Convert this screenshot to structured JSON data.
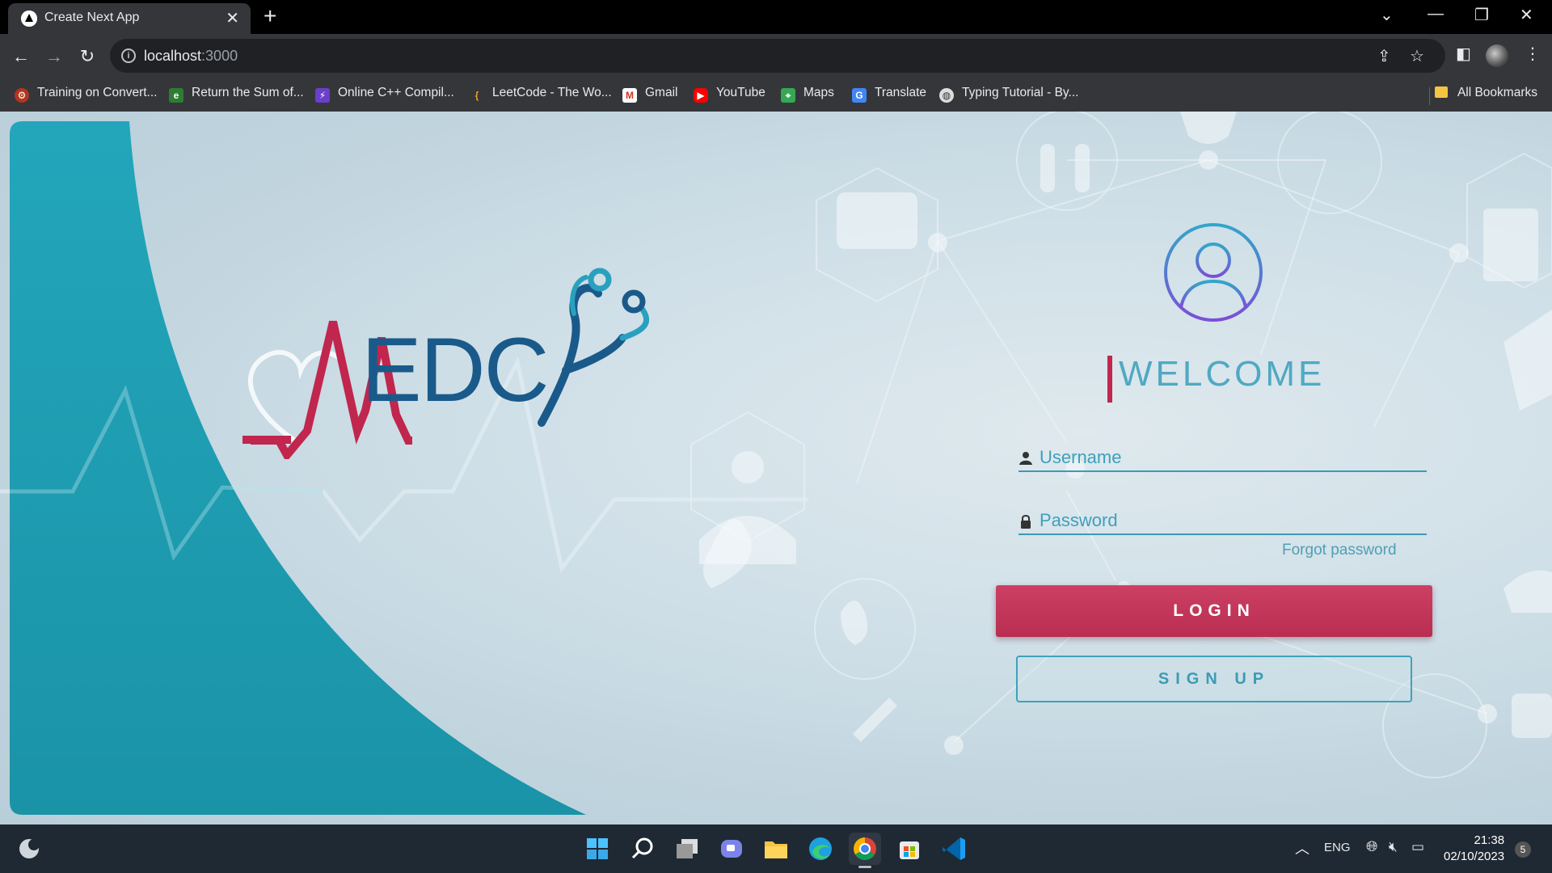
{
  "browser": {
    "tab_title": "Create Next App",
    "url_host": "localhost",
    "url_port": ":3000",
    "bookmarks": [
      {
        "label": "Training on Convert...",
        "icon": "codewars-icon",
        "color": "#b1361e"
      },
      {
        "label": "Return the Sum of...",
        "icon": "edabit-icon",
        "color": "#2e7d32"
      },
      {
        "label": "Online C++ Compil...",
        "icon": "bolt-icon",
        "color": "#6a3fc9"
      },
      {
        "label": "LeetCode - The Wo...",
        "icon": "leetcode-icon",
        "color": "#f0a020"
      },
      {
        "label": "Gmail",
        "icon": "gmail-icon",
        "color": "#d93025"
      },
      {
        "label": "YouTube",
        "icon": "youtube-icon",
        "color": "#ff0000"
      },
      {
        "label": "Maps",
        "icon": "maps-icon",
        "color": "#34a853"
      },
      {
        "label": "Translate",
        "icon": "translate-icon",
        "color": "#4285f4"
      },
      {
        "label": "Typing Tutorial - By...",
        "icon": "globe-icon",
        "color": "#dddddd"
      }
    ],
    "all_bookmarks": "All Bookmarks"
  },
  "page": {
    "logo_text": "EDC",
    "welcome": "WELCOME",
    "username_placeholder": "Username",
    "password_placeholder": "Password",
    "forgot_password": "Forgot password",
    "login_label": "LOGIN",
    "signup_label": "SIGN UP"
  },
  "taskbar": {
    "lang": "ENG",
    "time": "21:38",
    "date": "02/10/2023",
    "notifications": "5"
  },
  "colors": {
    "teal": "#1e9fb3",
    "brand_red": "#c0264e",
    "brand_blue": "#1a5a8a",
    "accent_teal": "#3ea0bb"
  }
}
